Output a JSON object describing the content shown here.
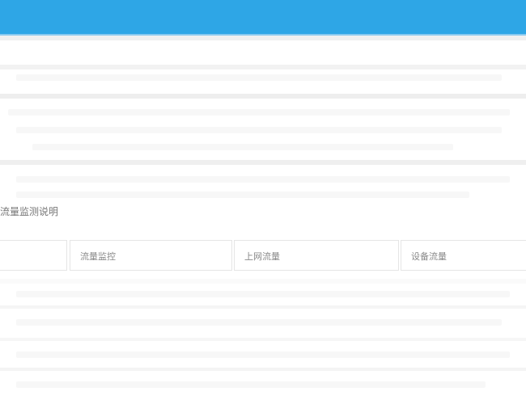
{
  "section": {
    "label": "流量监测说明"
  },
  "tabs": [
    {
      "label": ""
    },
    {
      "label": "流量监控"
    },
    {
      "label": "上网流量"
    },
    {
      "label": "设备流量"
    }
  ],
  "colors": {
    "header": "#2ea6e6",
    "header_edge": "#88c9ef",
    "divider": "#e5e5e5"
  }
}
